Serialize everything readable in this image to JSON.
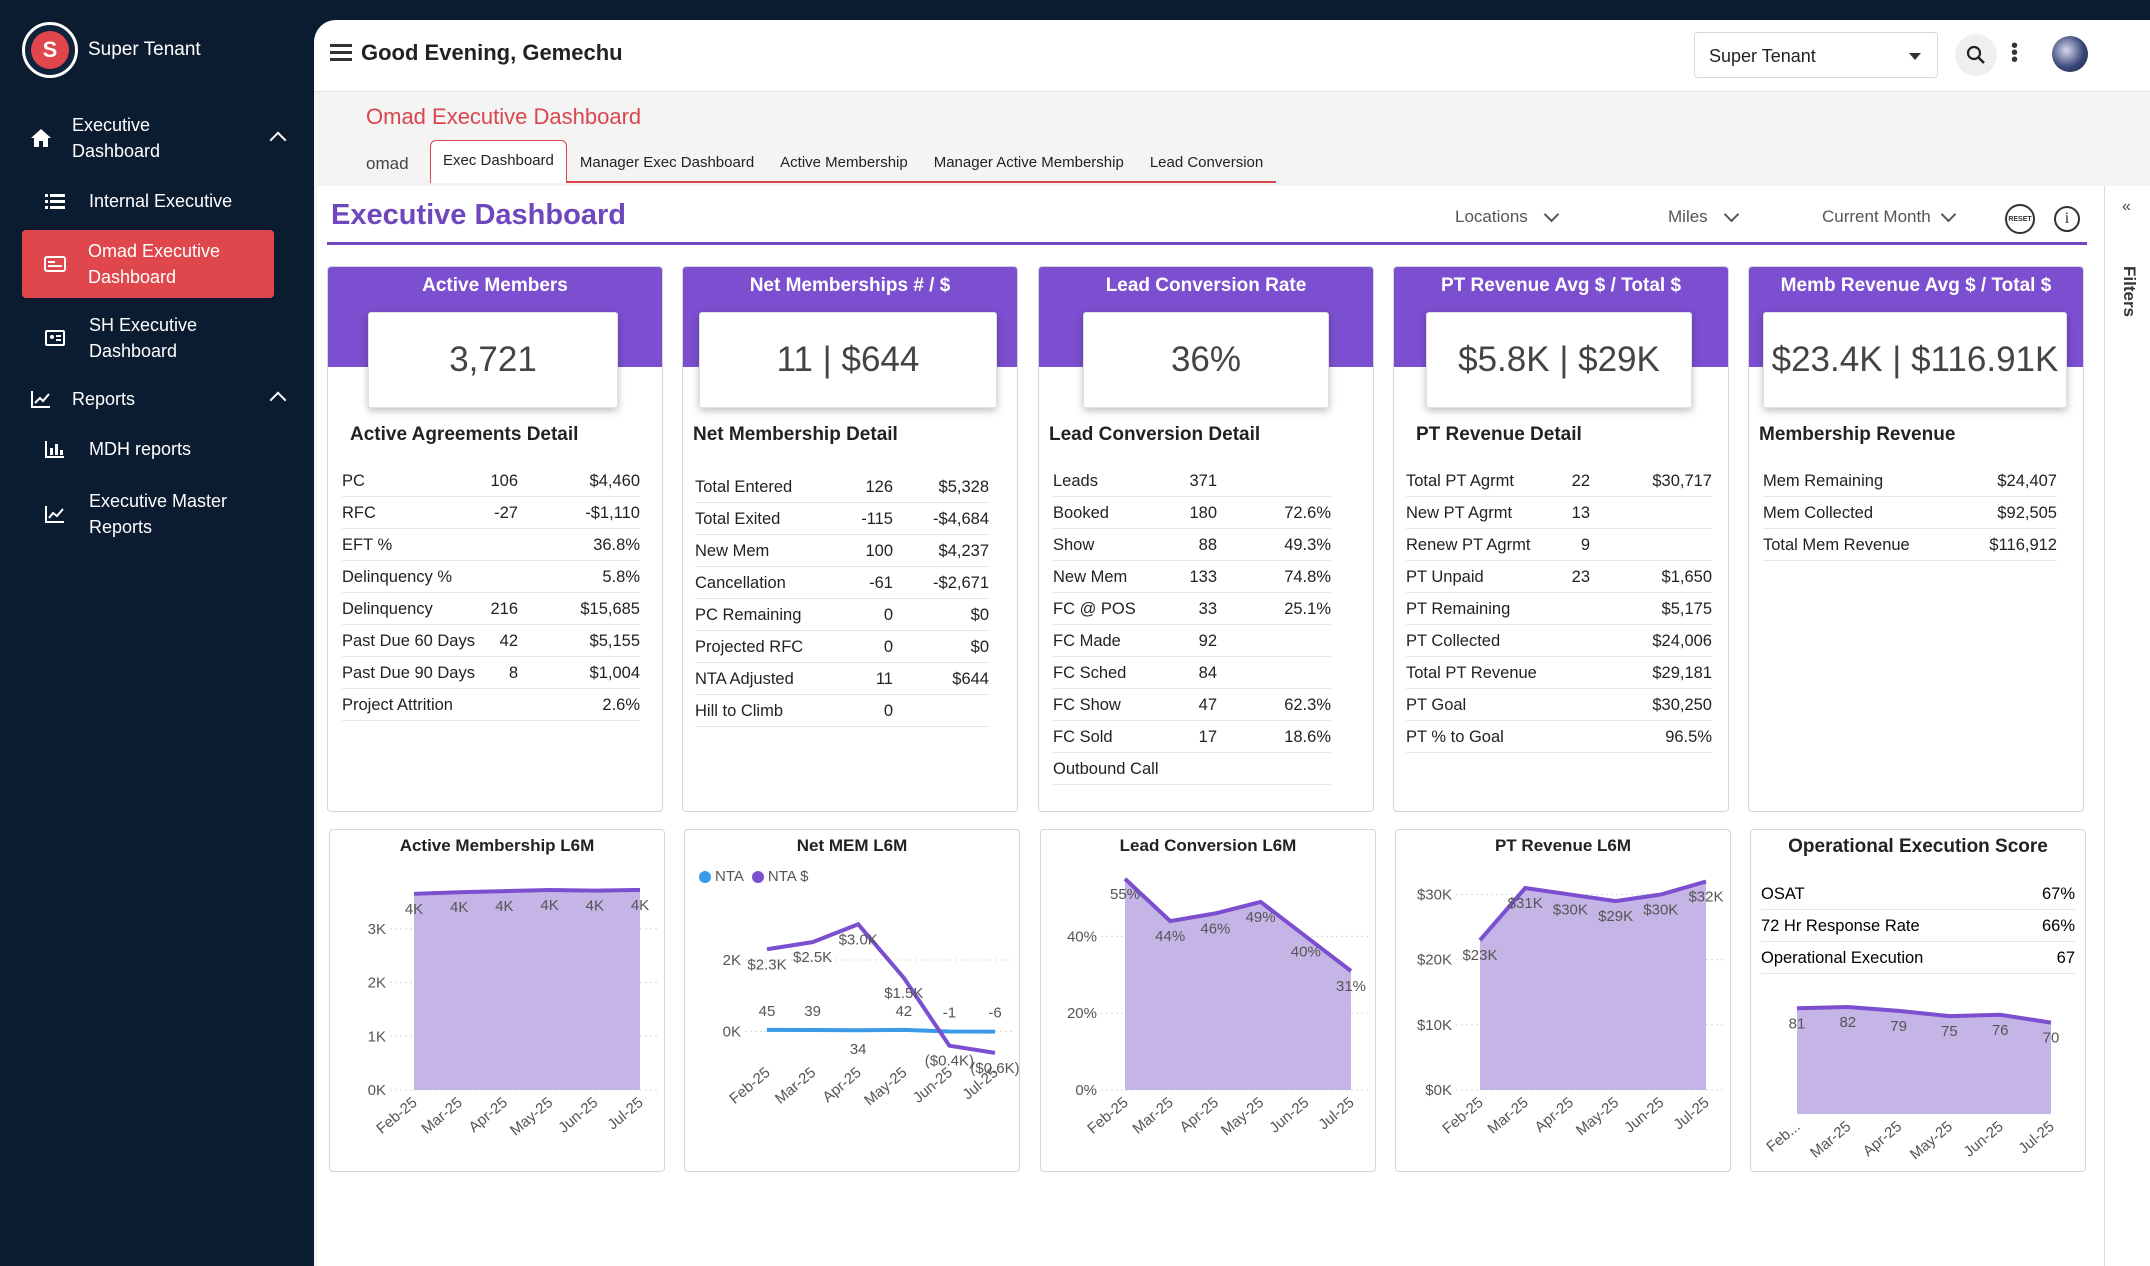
{
  "app": {
    "tenant_name": "Super Tenant"
  },
  "sidebar": {
    "items": [
      {
        "label": "Executive Dashboard",
        "icon": "home-icon"
      },
      {
        "label": "Internal Executive",
        "icon": "list-icon"
      },
      {
        "label": "Omad Executive Dashboard",
        "icon": "dashboard-icon"
      },
      {
        "label": "SH Executive Dashboard",
        "icon": "id-card-icon"
      },
      {
        "label": "Reports",
        "icon": "chart-line-icon"
      },
      {
        "label": "MDH reports",
        "icon": "bar-chart-icon"
      },
      {
        "label": "Executive Master Reports",
        "icon": "area-chart-icon"
      }
    ],
    "active_color": "#e0474c"
  },
  "topbar": {
    "greeting": "Good Evening, Gemechu",
    "tenant_select": "Super Tenant"
  },
  "report": {
    "title": "Omad Executive Dashboard",
    "tabs_label": "omad",
    "tabs": [
      "Exec Dashboard",
      "Manager Exec Dashboard",
      "Active Membership",
      "Manager Active Membership",
      "Lead Conversion"
    ]
  },
  "dashboard": {
    "title": "Executive Dashboard",
    "slicers": [
      "Locations",
      "Miles",
      "Current Month"
    ],
    "reset_label": "RESET",
    "filters_label": "Filters",
    "accent": "#7b4fcf"
  },
  "cards": [
    {
      "title": "Active Members",
      "kpi": "3,721",
      "detail_title": "Active Agreements Detail",
      "rows": [
        [
          "PC",
          "106",
          "$4,460"
        ],
        [
          "RFC",
          "-27",
          "-$1,110"
        ],
        [
          "EFT %",
          "",
          "36.8%"
        ],
        [
          "Delinquency %",
          "",
          "5.8%"
        ],
        [
          "Delinquency",
          "216",
          "$15,685"
        ],
        [
          "Past Due 60 Days",
          "42",
          "$5,155"
        ],
        [
          "Past Due 90 Days",
          "8",
          "$1,004"
        ],
        [
          "Project Attrition",
          "",
          "2.6%"
        ]
      ]
    },
    {
      "title": "Net Memberships # / $",
      "kpi": "11 | $644",
      "detail_title": "Net Membership Detail",
      "rows": [
        [
          "Total Entered",
          "126",
          "$5,328"
        ],
        [
          "Total Exited",
          "-115",
          "-$4,684"
        ],
        [
          "New Mem",
          "100",
          "$4,237"
        ],
        [
          "Cancellation",
          "-61",
          "-$2,671"
        ],
        [
          "PC Remaining",
          "0",
          "$0"
        ],
        [
          "Projected RFC",
          "0",
          "$0"
        ],
        [
          "NTA Adjusted",
          "11",
          "$644"
        ],
        [
          "Hill to Climb",
          "0",
          ""
        ]
      ]
    },
    {
      "title": "Lead Conversion Rate",
      "kpi": "36%",
      "detail_title": "Lead Conversion Detail",
      "rows": [
        [
          "Leads",
          "371",
          ""
        ],
        [
          "Booked",
          "180",
          "72.6%"
        ],
        [
          "Show",
          "88",
          "49.3%"
        ],
        [
          "New Mem",
          "133",
          "74.8%"
        ],
        [
          "FC @ POS",
          "33",
          "25.1%"
        ],
        [
          "FC Made",
          "92",
          ""
        ],
        [
          "FC Sched",
          "84",
          ""
        ],
        [
          "FC Show",
          "47",
          "62.3%"
        ],
        [
          "FC Sold",
          "17",
          "18.6%"
        ],
        [
          "Outbound Call",
          "",
          ""
        ]
      ]
    },
    {
      "title": "PT Revenue Avg $ / Total $",
      "kpi": "$5.8K | $29K",
      "detail_title": "PT Revenue Detail",
      "rows": [
        [
          "Total PT Agrmt",
          "22",
          "$30,717"
        ],
        [
          "New PT Agrmt",
          "13",
          ""
        ],
        [
          "Renew PT Agrmt",
          "9",
          ""
        ],
        [
          "PT Unpaid",
          "23",
          "$1,650"
        ],
        [
          "PT Remaining",
          "",
          "$5,175"
        ],
        [
          "PT Collected",
          "",
          "$24,006"
        ],
        [
          "Total PT Revenue",
          "",
          "$29,181"
        ],
        [
          "PT Goal",
          "",
          "$30,250"
        ],
        [
          "PT % to Goal",
          "",
          "96.5%"
        ]
      ]
    },
    {
      "title": "Memb Revenue Avg $ / Total $",
      "kpi": "$23.4K | $116.91K",
      "detail_title": "Membership Revenue",
      "rows": [
        [
          "Mem Remaining",
          "",
          "$24,407"
        ],
        [
          "Mem Collected",
          "",
          "$92,505"
        ],
        [
          "Total Mem Revenue",
          "",
          "$116,912"
        ]
      ]
    }
  ],
  "chart_data": [
    {
      "type": "area",
      "title": "Active Membership L6M",
      "categories": [
        "Feb-25",
        "Mar-25",
        "Apr-25",
        "May-25",
        "Jun-25",
        "Jul-25"
      ],
      "values": [
        3650,
        3680,
        3700,
        3720,
        3710,
        3721
      ],
      "data_labels": [
        "4K",
        "4K",
        "4K",
        "4K",
        "4K",
        "4K"
      ],
      "yticks": [
        "0K",
        "1K",
        "2K",
        "3K"
      ],
      "ylim": [
        0,
        4000
      ]
    },
    {
      "type": "line",
      "title": "Net MEM L6M",
      "categories": [
        "Feb-25",
        "Mar-25",
        "Apr-25",
        "May-25",
        "Jun-25",
        "Jul-25"
      ],
      "series": [
        {
          "name": "NTA",
          "color": "#3b9be8",
          "values": [
            45,
            39,
            34,
            42,
            -1,
            -6
          ],
          "data_labels": [
            "45",
            "39",
            "34",
            "42",
            "-1",
            "-6"
          ]
        },
        {
          "name": "NTA $",
          "color": "#7b4fcf",
          "values": [
            2300,
            2500,
            3000,
            1500,
            -400,
            -600
          ],
          "data_labels": [
            "$2.3K",
            "$2.5K",
            "$3.0K",
            "$1.5K",
            "($0.4K)",
            "($0.6K)"
          ]
        }
      ],
      "yticks": [
        "0K",
        "2K"
      ],
      "ylim": [
        -800,
        3400
      ]
    },
    {
      "type": "area",
      "title": "Lead Conversion L6M",
      "categories": [
        "Feb-25",
        "Mar-25",
        "Apr-25",
        "May-25",
        "Jun-25",
        "Jul-25"
      ],
      "values": [
        55,
        44,
        46,
        49,
        40,
        31
      ],
      "data_labels": [
        "55%",
        "44%",
        "46%",
        "49%",
        "40%",
        "31%"
      ],
      "yticks": [
        "0%",
        "20%",
        "40%"
      ],
      "ylim": [
        0,
        56
      ]
    },
    {
      "type": "area",
      "title": "PT Revenue L6M",
      "categories": [
        "Feb-25",
        "Mar-25",
        "Apr-25",
        "May-25",
        "Jun-25",
        "Jul-25"
      ],
      "values": [
        23000,
        31000,
        30000,
        29000,
        30000,
        32000
      ],
      "data_labels": [
        "$23K",
        "$31K",
        "$30K",
        "$29K",
        "$30K",
        "$32K"
      ],
      "yticks": [
        "$0K",
        "$10K",
        "$20K",
        "$30K"
      ],
      "ylim": [
        0,
        33000
      ]
    },
    {
      "type": "area",
      "title": "Operational Execution Score",
      "categories": [
        "Feb...",
        "Mar-25",
        "Apr-25",
        "May-25",
        "Jun-25",
        "Jul-25"
      ],
      "values": [
        81,
        82,
        79,
        75,
        76,
        70
      ],
      "data_labels": [
        "81",
        "82",
        "79",
        "75",
        "76",
        "70"
      ],
      "ylim": [
        0,
        95
      ],
      "table": [
        [
          "OSAT",
          "67%"
        ],
        [
          "72 Hr Response Rate",
          "66%"
        ],
        [
          "Operational Execution",
          "67"
        ]
      ]
    }
  ]
}
